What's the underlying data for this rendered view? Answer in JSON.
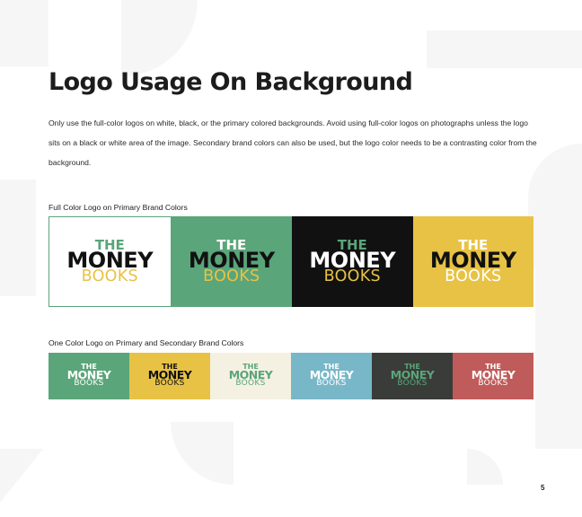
{
  "title": "Logo Usage On Background",
  "intro": "Only use the full-color logos on white, black, or the primary colored backgrounds. Avoid using full-color logos on photographs unless the logo sits on a black or white area of the image. Secondary brand colors can also be used, but the logo color needs to be a contrasting color from the background.",
  "logo_text": {
    "line1": "THE",
    "line2": "MONEY",
    "line3": "BOOKS"
  },
  "full_color": {
    "label": "Full Color Logo on Primary Brand Colors",
    "swatches": [
      {
        "bg": "#ffffff",
        "the": "#5aa57a",
        "money": "#111111",
        "books": "#e8c245",
        "bordered": true
      },
      {
        "bg": "#5aa57a",
        "the": "#ffffff",
        "money": "#111111",
        "books": "#e8c245"
      },
      {
        "bg": "#111111",
        "the": "#5aa57a",
        "money": "#ffffff",
        "books": "#e8c245"
      },
      {
        "bg": "#e8c245",
        "the": "#ffffff",
        "money": "#111111",
        "books": "#ffffff"
      }
    ]
  },
  "one_color": {
    "label": "One Color Logo on Primary and Secondary Brand Colors",
    "swatches": [
      {
        "bg": "#5aa57a",
        "ink": "#ffffff"
      },
      {
        "bg": "#e8c245",
        "ink": "#111111"
      },
      {
        "bg": "#f5f1e2",
        "ink": "#5aa57a"
      },
      {
        "bg": "#77b7c8",
        "ink": "#ffffff"
      },
      {
        "bg": "#3a3c39",
        "ink": "#5aa57a"
      },
      {
        "bg": "#bf5b5a",
        "ink": "#ffffff"
      }
    ]
  },
  "page_number": "5",
  "colors": {
    "watermark": "#f6f6f6"
  }
}
